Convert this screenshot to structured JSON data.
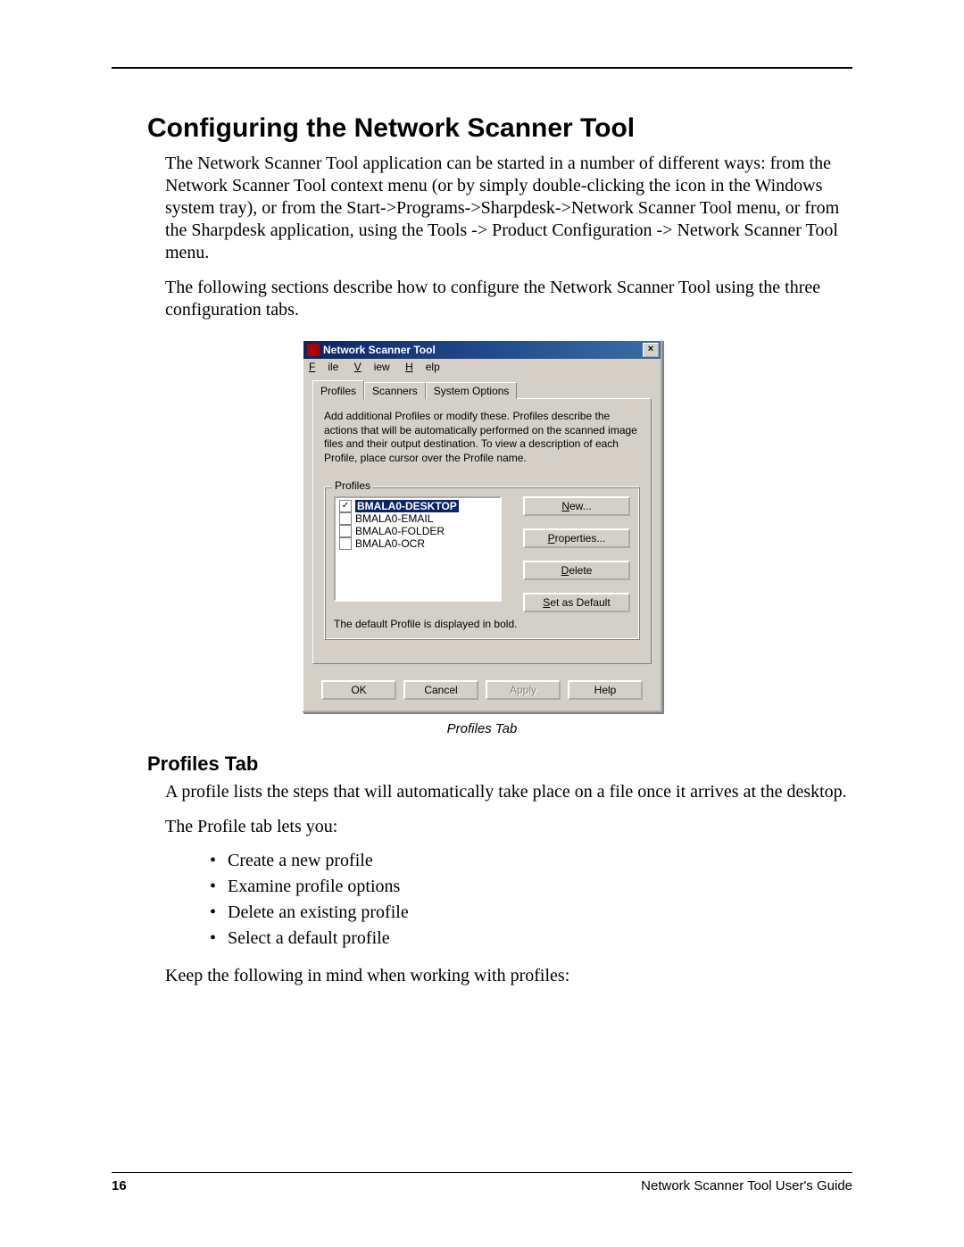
{
  "page": {
    "heading": "Configuring the Network Scanner Tool",
    "para1": "The Network Scanner Tool application can be started in a number of different ways: from the Network Scanner Tool context menu (or by simply double-clicking the icon in the Windows system tray), or from the Start->Programs->Sharpdesk->Network Scanner Tool menu, or from the Sharpdesk application, using the Tools -> Product Configuration -> Network Scanner Tool menu.",
    "para2": "The following sections describe how to configure the Network Scanner Tool using the three configuration tabs.",
    "caption": "Profiles Tab",
    "subheading": "Profiles Tab",
    "para3": "A profile lists the steps that will automatically take place on a file once it arrives at the desktop.",
    "para4": "The Profile tab lets you:",
    "bullets": [
      "Create a new profile",
      "Examine profile options",
      "Delete an existing profile",
      "Select a default profile"
    ],
    "para5": "Keep the following in mind when working with profiles:",
    "footer_left": "16",
    "footer_right": "Network Scanner Tool User's Guide"
  },
  "dialog": {
    "title": "Network Scanner Tool",
    "menu": {
      "file": "File",
      "view": "View",
      "help": "Help"
    },
    "tabs": {
      "profiles": "Profiles",
      "scanners": "Scanners",
      "system": "System Options"
    },
    "description": "Add additional Profiles or modify these. Profiles describe the actions that will be automatically performed on the scanned image files and their output destination. To view a description of each  Profile, place cursor over the Profile name.",
    "group_label": "Profiles",
    "items": [
      {
        "label": "BMALA0-DESKTOP",
        "checked": true,
        "selected": true
      },
      {
        "label": "BMALA0-EMAIL",
        "checked": false,
        "selected": false
      },
      {
        "label": "BMALA0-FOLDER",
        "checked": false,
        "selected": false
      },
      {
        "label": "BMALA0-OCR",
        "checked": false,
        "selected": false
      }
    ],
    "buttons": {
      "new": "New...",
      "properties": "Properties...",
      "delete": "Delete",
      "setdefault": "Set as Default"
    },
    "note": "The default Profile is displayed in bold.",
    "bottom": {
      "ok": "OK",
      "cancel": "Cancel",
      "apply": "Apply",
      "help": "Help"
    }
  }
}
